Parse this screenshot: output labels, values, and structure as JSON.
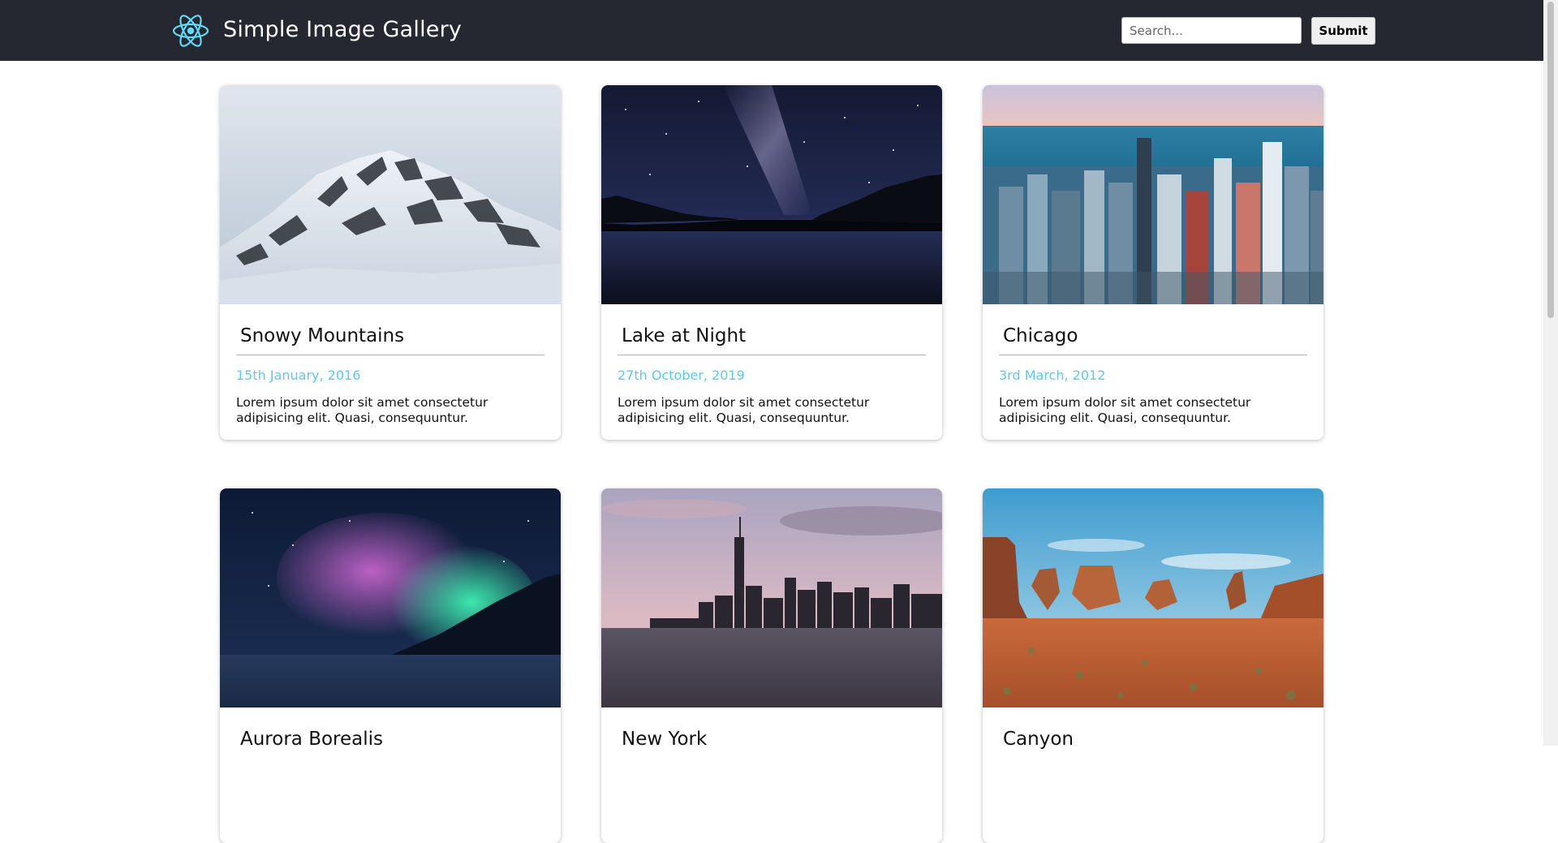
{
  "header": {
    "app_title": "Simple Image Gallery",
    "logo_icon": "react-atom-icon",
    "search_placeholder": "Search...",
    "submit_label": "Submit"
  },
  "colors": {
    "navbar": "#252830",
    "accent": "#5fc8e6",
    "logo": "#61dafb"
  },
  "gallery": {
    "cards": [
      {
        "title": "Snowy Mountains",
        "date": "15th January, 2016",
        "description": "Lorem ipsum dolor sit amet consectetur adipisicing elit. Quasi, consequuntur."
      },
      {
        "title": "Lake at Night",
        "date": "27th October, 2019",
        "description": "Lorem ipsum dolor sit amet consectetur adipisicing elit. Quasi, consequuntur."
      },
      {
        "title": "Chicago",
        "date": "3rd March, 2012",
        "description": "Lorem ipsum dolor sit amet consectetur adipisicing elit. Quasi, consequuntur."
      },
      {
        "title": "Aurora Borealis"
      },
      {
        "title": "New York"
      },
      {
        "title": "Canyon"
      }
    ]
  }
}
